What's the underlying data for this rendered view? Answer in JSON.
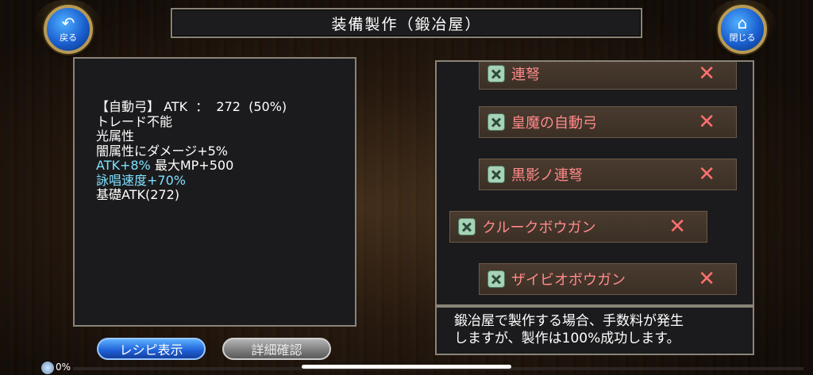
{
  "header": {
    "title": "装備製作（鍛冶屋）",
    "back_label": "戻る",
    "close_label": "閉じる",
    "back_icon": "undo-arrow-icon",
    "close_icon": "home-icon"
  },
  "item_info": {
    "line1": "【自動弓】 ATK  ：  272  (50%)",
    "line2": "トレード不能",
    "line3": "光属性",
    "line4": "闇属性にダメージ+5%",
    "line5a": "ATK+8%",
    "line5b": " 最大MP+500",
    "line6": "詠唱速度+70%",
    "line7": "基礎ATK(272)"
  },
  "recipes": [
    {
      "label": "連弩"
    },
    {
      "label": "皇魔の自動弓"
    },
    {
      "label": "黒影ノ連弩"
    },
    {
      "label": "クルークボウガン"
    },
    {
      "label": "ザイビオボウガン"
    }
  ],
  "notice": {
    "line1": "鍛冶屋で製作する場合、手数料が発生",
    "line2": "しますが、製作は100%成功します。"
  },
  "buttons": {
    "recipe_display": "レシピ表示",
    "detail_confirm": "詳細確認"
  },
  "progress": {
    "text": "0%",
    "value": 0
  },
  "colors": {
    "recipe_text": "#ff8a8a",
    "bonus_text": "#7fe0ff"
  }
}
